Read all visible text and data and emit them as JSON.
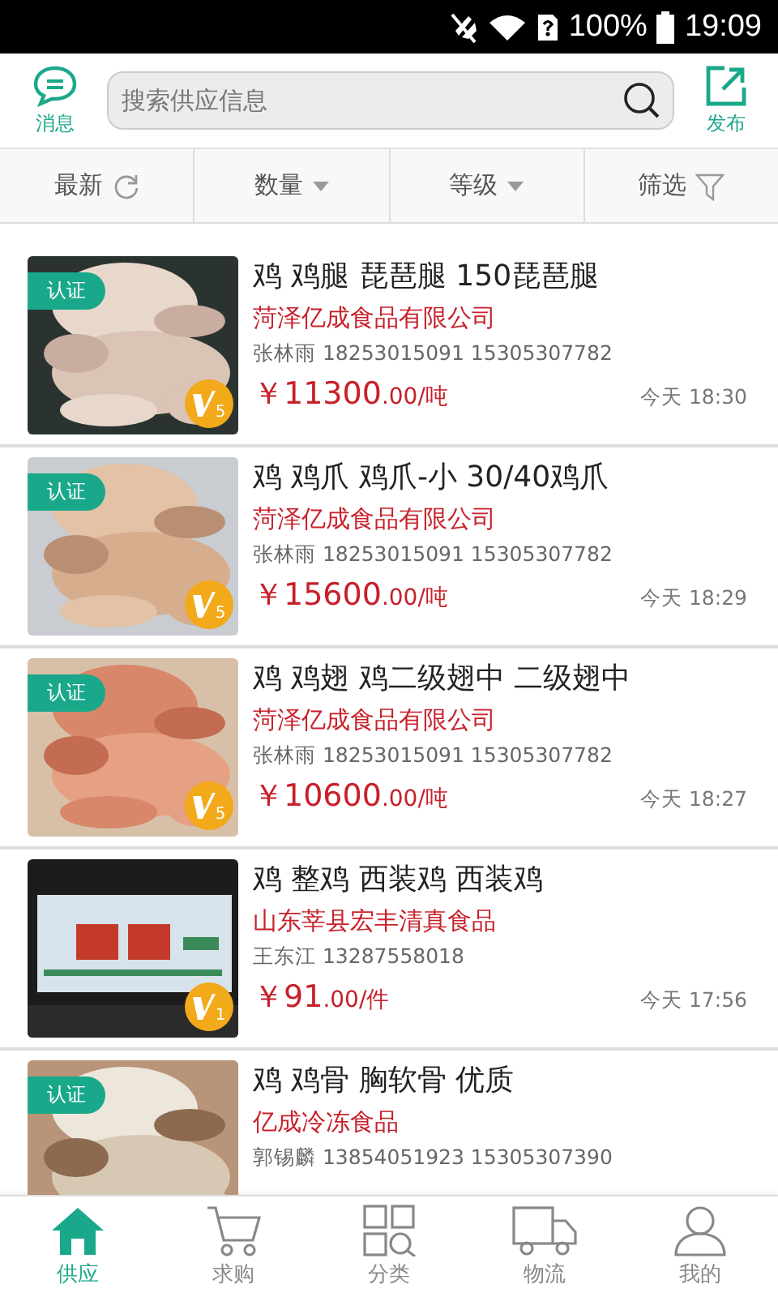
{
  "status_bar": {
    "battery": "100%",
    "time": "19:09"
  },
  "header": {
    "left": {
      "label": "消息"
    },
    "search": {
      "placeholder": "搜索供应信息"
    },
    "right": {
      "label": "发布"
    }
  },
  "filters": [
    {
      "label": "最新",
      "kind": "refresh"
    },
    {
      "label": "数量",
      "kind": "dropdown"
    },
    {
      "label": "等级",
      "kind": "dropdown"
    },
    {
      "label": "筛选",
      "kind": "filter"
    }
  ],
  "items": [
    {
      "title": "鸡 鸡腿 琵琶腿 150琵琶腿",
      "badge": "认证",
      "vip": "5",
      "company": "菏泽亿成食品有限公司",
      "contact": "张林雨 18253015091 15305307782",
      "price": "￥11300",
      "price_unit": ".00/吨",
      "time": "今天 18:30"
    },
    {
      "title": "鸡 鸡爪 鸡爪-小 30/40鸡爪",
      "badge": "认证",
      "vip": "5",
      "company": "菏泽亿成食品有限公司",
      "contact": "张林雨 18253015091 15305307782",
      "price": "￥15600",
      "price_unit": ".00/吨",
      "time": "今天 18:29"
    },
    {
      "title": "鸡 鸡翅 鸡二级翅中 二级翅中",
      "badge": "认证",
      "vip": "5",
      "company": "菏泽亿成食品有限公司",
      "contact": "张林雨 18253015091 15305307782",
      "price": "￥10600",
      "price_unit": ".00/吨",
      "time": "今天 18:27"
    },
    {
      "title": "鸡 整鸡 西装鸡 西装鸡",
      "vip": "1",
      "company": "山东莘县宏丰清真食品",
      "contact": "王东江 13287558018",
      "price": "￥91",
      "price_unit": ".00/件",
      "time": "今天 17:56"
    },
    {
      "title": "鸡 鸡骨 胸软骨 优质",
      "badge": "认证",
      "company": "亿成冷冻食品",
      "contact": "郭锡麟 13854051923 15305307390"
    }
  ],
  "tab_bar": [
    {
      "label": "供应",
      "kind": "home",
      "selected": true
    },
    {
      "label": "求购",
      "kind": "cart",
      "selected": false
    },
    {
      "label": "分类",
      "kind": "grid",
      "selected": false
    },
    {
      "label": "物流",
      "kind": "truck",
      "selected": false
    },
    {
      "label": "我的",
      "kind": "person",
      "selected": false
    }
  ]
}
